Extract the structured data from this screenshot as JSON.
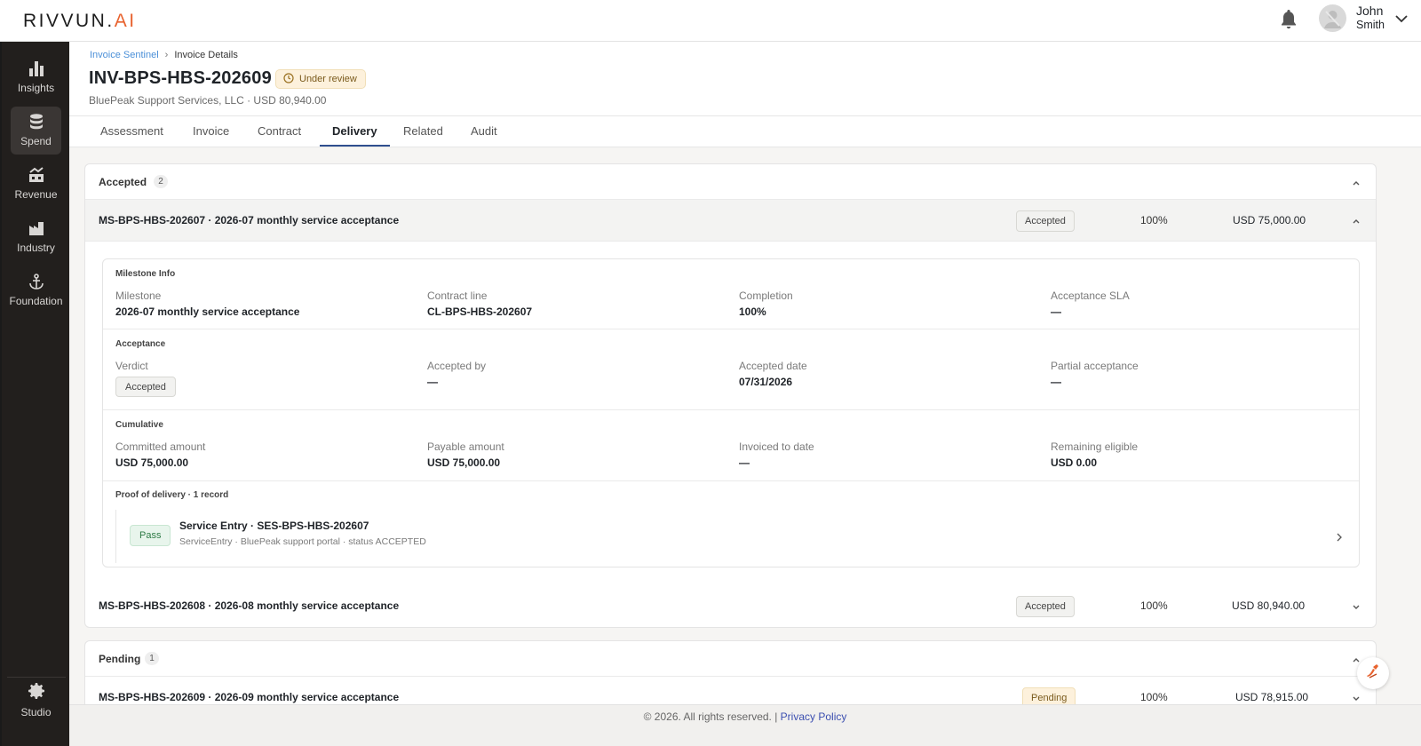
{
  "brand": {
    "name_main": "RIVVUN.",
    "name_accent": "AI"
  },
  "user": {
    "first": "John",
    "last": "Smith"
  },
  "sidebar": {
    "items": [
      {
        "label": "Insights",
        "icon": "bar-chart-icon"
      },
      {
        "label": "Spend",
        "icon": "database-icon",
        "active": true
      },
      {
        "label": "Revenue",
        "icon": "revenue-icon"
      },
      {
        "label": "Industry",
        "icon": "factory-icon"
      },
      {
        "label": "Foundation",
        "icon": "anchor-icon"
      }
    ],
    "bottom": {
      "label": "Studio",
      "icon": "gear-icon"
    }
  },
  "breadcrumb": {
    "root": "Invoice Sentinel",
    "current": "Invoice Details"
  },
  "invoice": {
    "id": "INV-BPS-HBS-202609",
    "status": "Under review",
    "subtitle": "BluePeak Support Services, LLC · USD 80,940.00"
  },
  "tabs": [
    "Assessment",
    "Invoice",
    "Contract",
    "Delivery",
    "Related",
    "Audit"
  ],
  "active_tab": "Delivery",
  "groups": {
    "accepted": {
      "title": "Accepted",
      "count": "2",
      "rows": [
        {
          "name": "MS-BPS-HBS-202607 · 2026-07 monthly service acceptance",
          "status": "Accepted",
          "pct": "100%",
          "amount": "USD 75,000.00"
        },
        {
          "name": "MS-BPS-HBS-202608 · 2026-08 monthly service acceptance",
          "status": "Accepted",
          "pct": "100%",
          "amount": "USD 80,940.00"
        }
      ]
    },
    "pending": {
      "title": "Pending",
      "count": "1",
      "rows": [
        {
          "name": "MS-BPS-HBS-202609 · 2026-09 monthly service acceptance",
          "status": "Pending",
          "pct": "100%",
          "amount": "USD 78,915.00"
        }
      ]
    }
  },
  "detail": {
    "milestone_info": {
      "title": "Milestone Info",
      "fields": [
        {
          "label": "Milestone",
          "value": "2026-07 monthly service acceptance"
        },
        {
          "label": "Contract line",
          "value": "CL-BPS-HBS-202607"
        },
        {
          "label": "Completion",
          "value": "100%"
        },
        {
          "label": "Acceptance SLA",
          "value": "—"
        }
      ]
    },
    "acceptance": {
      "title": "Acceptance",
      "verdict_label": "Verdict",
      "verdict": "Accepted",
      "fields": [
        {
          "label": "Accepted by",
          "value": "—"
        },
        {
          "label": "Accepted date",
          "value": "07/31/2026"
        },
        {
          "label": "Partial acceptance",
          "value": "—"
        }
      ]
    },
    "cumulative": {
      "title": "Cumulative",
      "fields": [
        {
          "label": "Committed amount",
          "value": "USD 75,000.00"
        },
        {
          "label": "Payable amount",
          "value": "USD 75,000.00"
        },
        {
          "label": "Invoiced to date",
          "value": "—"
        },
        {
          "label": "Remaining eligible",
          "value": "USD 0.00"
        }
      ]
    },
    "proof": {
      "title": "Proof of delivery · 1 record",
      "result": "Pass",
      "record_title": "Service Entry · SES-BPS-HBS-202607",
      "record_sub": "ServiceEntry · BluePeak support portal · status ACCEPTED"
    }
  },
  "footer": {
    "text": "© 2026. All rights reserved. |",
    "link": "Privacy Policy"
  },
  "colors": {
    "accent": "#e8632f",
    "sidebar": "#221f1d",
    "tab_underline": "#2f4f8f",
    "link": "#4a8fd8"
  }
}
